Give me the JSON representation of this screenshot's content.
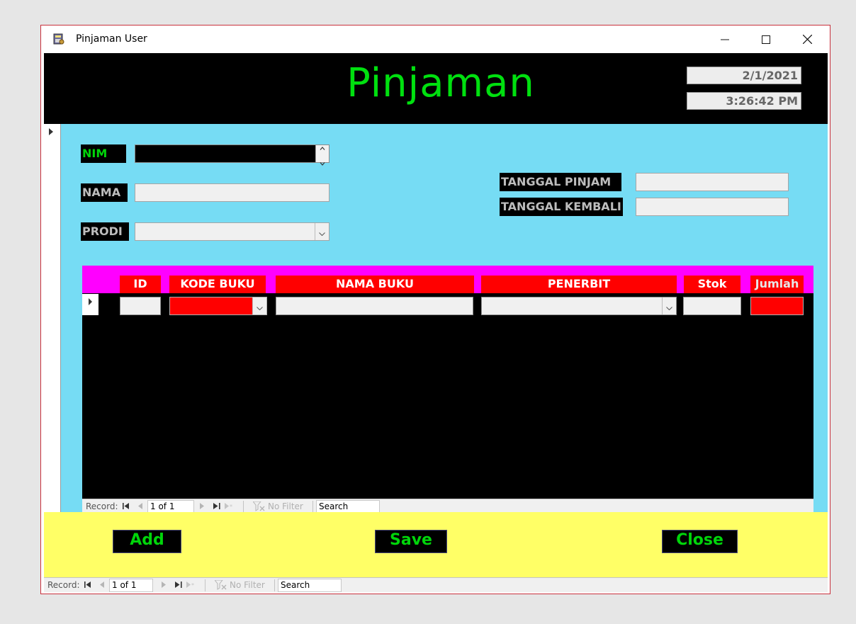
{
  "window": {
    "title": "Pinjaman User",
    "controls": {
      "minimize_icon": "minimize-icon",
      "maximize_icon": "maximize-icon",
      "close_icon": "close-icon"
    }
  },
  "header": {
    "title": "Pinjaman",
    "date": "2/1/2021",
    "time": "3:26:42 PM"
  },
  "form": {
    "nim_label": "NIM",
    "nim_value": "",
    "nama_label": "NAMA",
    "nama_value": "",
    "prodi_label": "PRODI",
    "prodi_value": "",
    "tanggal_pinjam_label": "TANGGAL PINJAM",
    "tanggal_pinjam_value": "",
    "tanggal_kembali_label": "TANGGAL KEMBALI",
    "tanggal_kembali_value": ""
  },
  "subform": {
    "columns": [
      "ID",
      "KODE BUKU",
      "NAMA BUKU",
      "PENERBIT",
      "Stok",
      "Jumlah"
    ],
    "navbar": {
      "record_label": "Record:",
      "record_position": "1 of 1",
      "filter_label": "No Filter",
      "search_placeholder": "Search"
    }
  },
  "buttons": {
    "add": "Add",
    "save": "Save",
    "close": "Close"
  },
  "main_navbar": {
    "record_label": "Record:",
    "record_position": "1 of 1",
    "filter_label": "No Filter",
    "search_placeholder": "Search"
  },
  "colors": {
    "title_green": "#00e00f",
    "detail_cyan": "#76dcf4",
    "header_magenta": "#ff00ff",
    "column_red": "#ff0000",
    "footer_yellow": "#ffff66"
  }
}
